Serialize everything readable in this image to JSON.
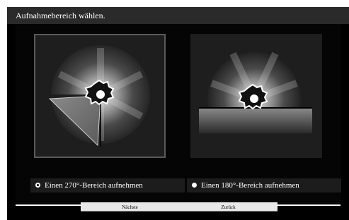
{
  "window": {
    "title": "Aufnahmebereich wählen."
  },
  "options": [
    {
      "label": "Einen 270°-Bereich aufnehmen",
      "selected": true
    },
    {
      "label": "Einen 180°-Bereich aufnehmen",
      "selected": false
    }
  ],
  "buttons": {
    "next_label": "Nächste",
    "back_label": "Zurück"
  },
  "colors": {
    "background": "#000000",
    "panel": "#1c1c1c",
    "separator": "#ffffff",
    "button": "#e8e8e8"
  }
}
